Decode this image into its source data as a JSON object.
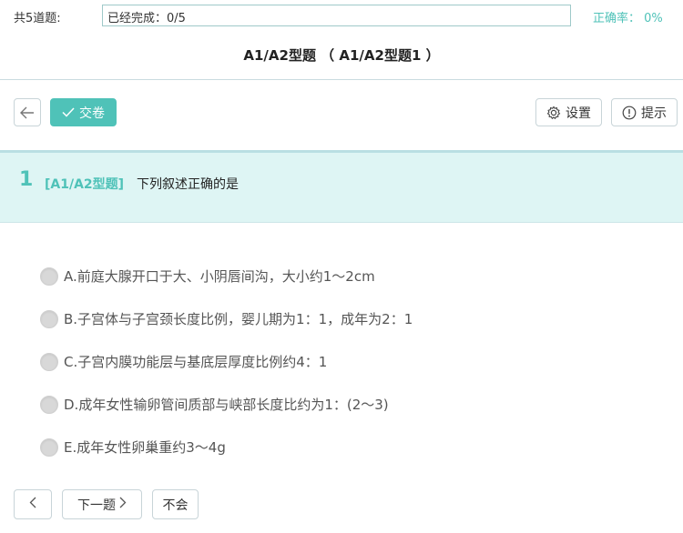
{
  "header": {
    "total_label": "共5道题:",
    "progress_text": "已经完成：0/5",
    "progress_fraction": 0,
    "accuracy_label": "正确率：",
    "accuracy_value": "0%"
  },
  "page_title": "A1/A2型题 （ A1/A2型题1 ）",
  "toolbar": {
    "submit_label": "交卷",
    "settings_label": "设置",
    "hint_label": "提示"
  },
  "question": {
    "number": "1",
    "type": "[A1/A2型题]",
    "text": "下列叙述正确的是"
  },
  "options": [
    {
      "label": "A.前庭大腺开口于大、小阴唇间沟，大小约1～2cm"
    },
    {
      "label": "B.子宫体与子宫颈长度比例，婴儿期为1：1，成年为2：1"
    },
    {
      "label": "C.子宫内膜功能层与基底层厚度比例约4：1"
    },
    {
      "label": "D.成年女性输卵管间质部与峡部长度比约为1：(2～3)"
    },
    {
      "label": "E.成年女性卵巢重约3～4g"
    }
  ],
  "footer": {
    "next_label": "下一题",
    "skip_label": "不会"
  },
  "colors": {
    "accent": "#4fc2b8",
    "question_bg": "#def5f4"
  }
}
